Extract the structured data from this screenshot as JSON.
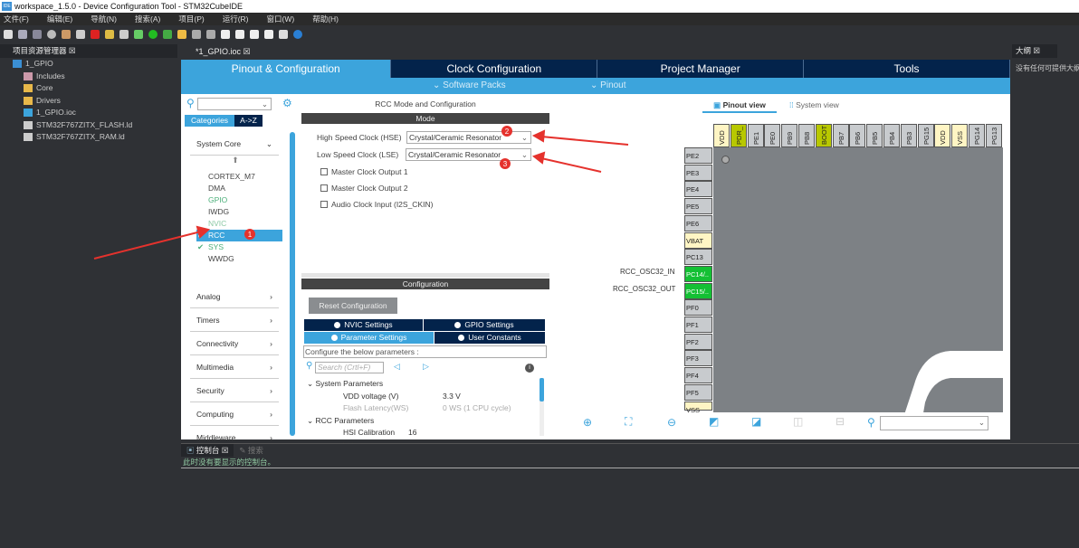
{
  "window": {
    "title": "workspace_1.5.0 - Device Configuration Tool - STM32CubeIDE",
    "icon": "IDE"
  },
  "menu": [
    "文件(F)",
    "编辑(E)",
    "导航(N)",
    "搜索(A)",
    "项目(P)",
    "运行(R)",
    "窗口(W)",
    "帮助(H)"
  ],
  "explorer": {
    "title": "项目资源管理器",
    "project": "1_GPIO",
    "items": [
      "Includes",
      "Core",
      "Drivers",
      "1_GPIO.ioc",
      "STM32F767ZITX_FLASH.ld",
      "STM32F767ZITX_RAM.ld"
    ]
  },
  "editor_tab": "*1_GPIO.ioc",
  "main_tabs": [
    "Pinout & Configuration",
    "Clock Configuration",
    "Project Manager",
    "Tools"
  ],
  "subbar": {
    "software_packs": "Software Packs",
    "pinout": "Pinout"
  },
  "categories": {
    "tab_categories": "Categories",
    "tab_az": "A->Z",
    "system_core": "System Core",
    "core_items": [
      "CORTEX_M7",
      "DMA",
      "GPIO",
      "IWDG",
      "NVIC",
      "RCC",
      "SYS",
      "WWDG"
    ],
    "groups": [
      "Analog",
      "Timers",
      "Connectivity",
      "Multimedia",
      "Security",
      "Computing",
      "Middleware"
    ]
  },
  "rcc": {
    "title": "RCC Mode and Configuration",
    "mode_header": "Mode",
    "hse_label": "High Speed Clock (HSE)",
    "hse_value": "Crystal/Ceramic Resonator",
    "lse_label": "Low Speed Clock (LSE)",
    "lse_value": "Crystal/Ceramic Resonator",
    "checkboxes": [
      "Master Clock Output 1",
      "Master Clock Output 2",
      "Audio Clock Input (I2S_CKIN)"
    ],
    "config_header": "Configuration",
    "reset_button": "Reset Configuration",
    "tabs": [
      "NVIC Settings",
      "GPIO Settings",
      "Parameter Settings",
      "User Constants"
    ],
    "configure_text": "Configure the below parameters :",
    "search_placeholder": "Search (Crtl+F)",
    "sections": [
      {
        "name": "System Parameters",
        "params": [
          [
            "VDD voltage (V)",
            "3.3 V"
          ],
          [
            "Flash Latency(WS)",
            "0 WS (1 CPU cycle)"
          ]
        ]
      },
      {
        "name": "RCC Parameters",
        "params": [
          [
            "HSI Calibration Value",
            "16"
          ]
        ]
      }
    ]
  },
  "annotations": [
    "1",
    "2",
    "3"
  ],
  "pinout": {
    "view_pinout": "Pinout view",
    "view_system": "System view",
    "top_pins": [
      "VDD",
      "PDR_",
      "PE1",
      "PE0",
      "PB9",
      "PB8",
      "BOOT",
      "PB7",
      "PB6",
      "PB5",
      "PB4",
      "PB3",
      "PG15",
      "VDD",
      "VSS",
      "PG14",
      "PG13"
    ],
    "left_pins": [
      "PE2",
      "PE3",
      "PE4",
      "PE5",
      "PE6",
      "VBAT",
      "PC13",
      "PC14/..",
      "PC15/..",
      "PF0",
      "PF1",
      "PF2",
      "PF3",
      "PF4",
      "PF5",
      "VSS"
    ],
    "signal_labels": {
      "PC14": "RCC_OSC32_IN",
      "PC15": "RCC_OSC32_OUT"
    }
  },
  "outline": {
    "title": "大纲",
    "message": "没有任何可提供大纲"
  },
  "console": {
    "tab": "控制台",
    "tab2": "搜索",
    "message": "此时没有要显示的控制台。"
  }
}
